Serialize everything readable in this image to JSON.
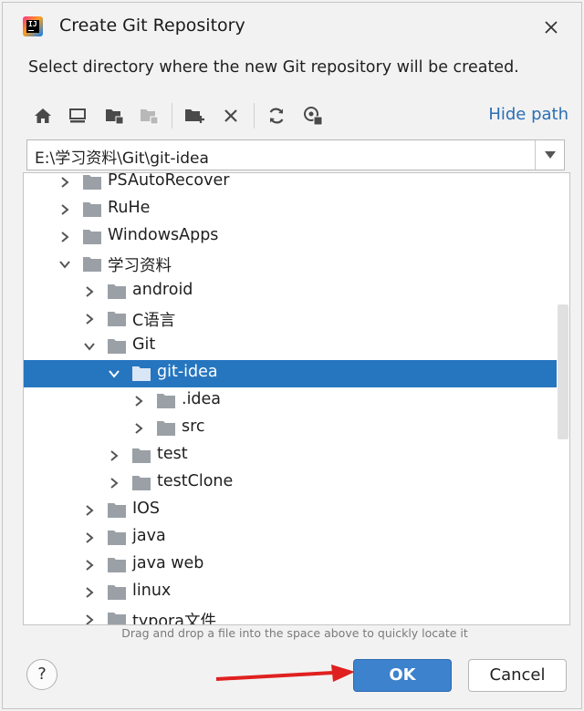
{
  "window": {
    "title": "Create Git Repository",
    "close_icon": "close-icon",
    "app_icon": "intellij-idea-icon"
  },
  "description": "Select directory where the new Git repository will be created.",
  "toolbar": {
    "buttons": [
      "home-icon",
      "desktop-icon",
      "project-folder-icon",
      "module-folder-icon",
      "new-folder-icon",
      "delete-icon",
      "refresh-icon",
      "show-hidden-icon"
    ],
    "hide_path": "Hide path"
  },
  "path": {
    "value": "E:\\学习资料\\Git\\git-idea"
  },
  "tree": {
    "items": [
      {
        "label": "PSAutoRecover",
        "depth": 1,
        "expanded": false,
        "selected": false
      },
      {
        "label": "RuHe",
        "depth": 1,
        "expanded": false,
        "selected": false
      },
      {
        "label": "WindowsApps",
        "depth": 1,
        "expanded": false,
        "selected": false
      },
      {
        "label": "学习资料",
        "depth": 1,
        "expanded": true,
        "selected": false
      },
      {
        "label": "android",
        "depth": 2,
        "expanded": false,
        "selected": false
      },
      {
        "label": "C语言",
        "depth": 2,
        "expanded": false,
        "selected": false
      },
      {
        "label": "Git",
        "depth": 2,
        "expanded": true,
        "selected": false
      },
      {
        "label": "git-idea",
        "depth": 3,
        "expanded": true,
        "selected": true
      },
      {
        "label": ".idea",
        "depth": 4,
        "expanded": false,
        "selected": false
      },
      {
        "label": "src",
        "depth": 4,
        "expanded": false,
        "selected": false
      },
      {
        "label": "test",
        "depth": 3,
        "expanded": false,
        "selected": false
      },
      {
        "label": "testClone",
        "depth": 3,
        "expanded": false,
        "selected": false
      },
      {
        "label": "IOS",
        "depth": 2,
        "expanded": false,
        "selected": false
      },
      {
        "label": "java",
        "depth": 2,
        "expanded": false,
        "selected": false
      },
      {
        "label": "java web",
        "depth": 2,
        "expanded": false,
        "selected": false
      },
      {
        "label": "linux",
        "depth": 2,
        "expanded": false,
        "selected": false
      },
      {
        "label": "typora文件",
        "depth": 2,
        "expanded": false,
        "selected": false
      }
    ]
  },
  "hint": "Drag and drop a file into the space above to quickly locate it",
  "buttons": {
    "help": "?",
    "ok": "OK",
    "cancel": "Cancel"
  },
  "colors": {
    "selection": "#2675bf",
    "ok_button": "#3d82cc",
    "link": "#2a6fb5",
    "annotation_arrow": "#e02020"
  }
}
